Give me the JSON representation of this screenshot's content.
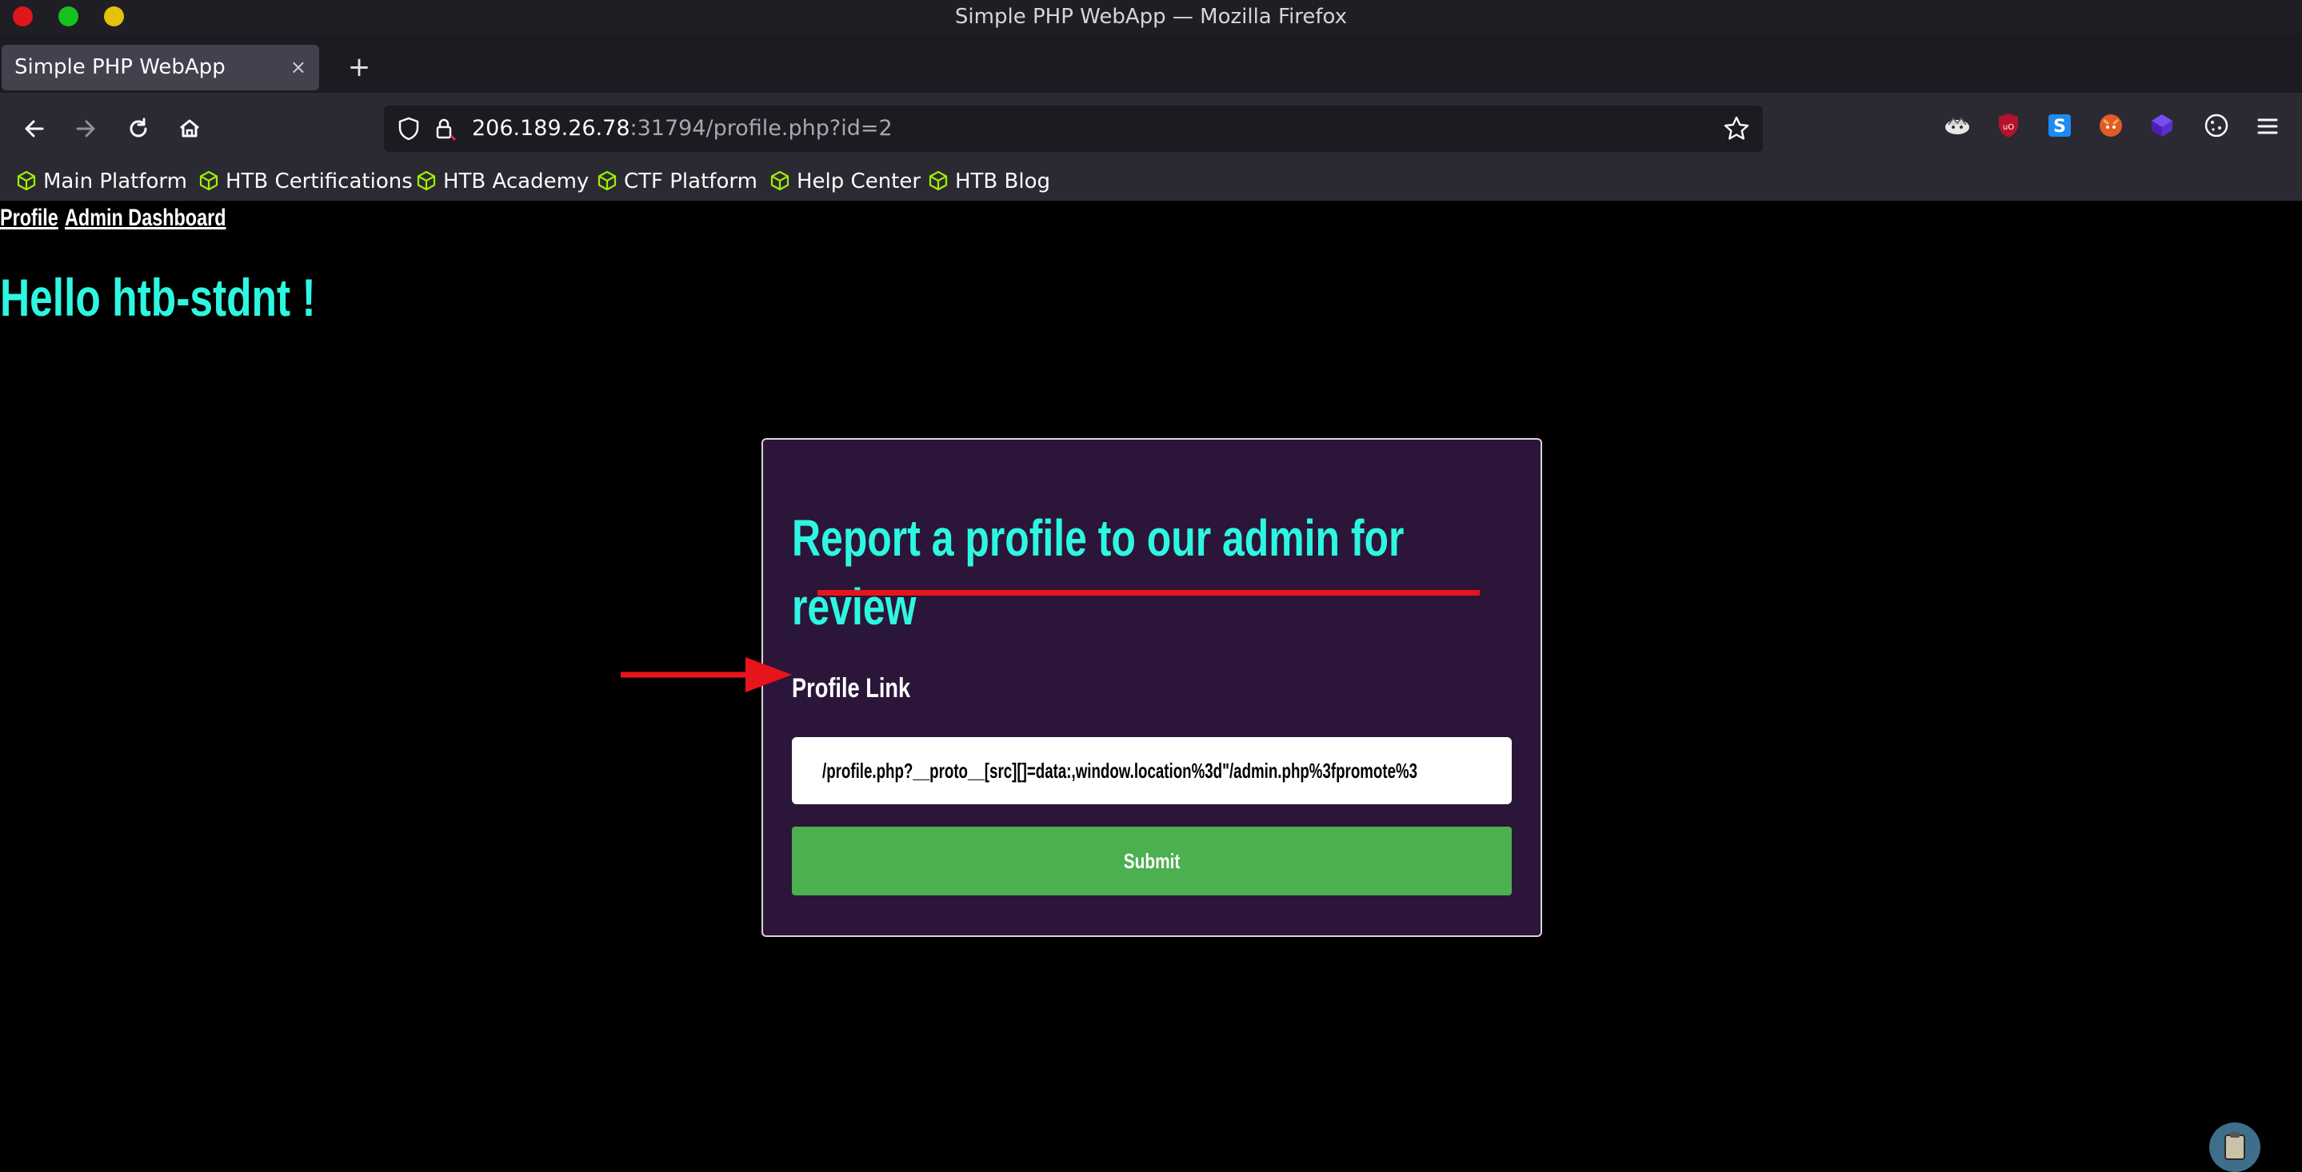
{
  "window": {
    "title": "Simple PHP WebApp — Mozilla Firefox"
  },
  "tab": {
    "label": "Simple PHP WebApp",
    "close": "×",
    "new_tab": "+"
  },
  "navbar": {
    "url_host": "206.189.26.78",
    "url_path": ":31794/profile.php?id=2",
    "icons": [
      "back-icon",
      "forward-icon",
      "reload-icon",
      "home-icon",
      "shield-icon",
      "lock-icon",
      "bookmark-star-icon"
    ]
  },
  "extensions": [
    "hack-the-box-icon",
    "ublock-origin-icon",
    "s-extension-icon",
    "fox-extension-icon",
    "cube-extension-icon",
    "cookie-icon",
    "hamburger-menu-icon"
  ],
  "bookmarks": [
    {
      "label": "Main Platform"
    },
    {
      "label": "HTB Certifications"
    },
    {
      "label": "HTB Academy"
    },
    {
      "label": "CTF Platform"
    },
    {
      "label": "Help Center"
    },
    {
      "label": "HTB Blog"
    }
  ],
  "page": {
    "nav": {
      "profile": "Profile",
      "admin": "Admin Dashboard"
    },
    "greeting": "Hello htb-stdnt !",
    "card": {
      "title": "Report a profile to our admin for review",
      "label": "Profile Link",
      "input_value": "/profile.php?__proto__[src][]=data:,window.location%3d\"/admin.php%3fpromote%3",
      "submit": "Submit"
    }
  },
  "colors": {
    "accent": "#2ef7e1",
    "card_bg": "#2b1639",
    "button": "#4caf50",
    "annotation": "#e8141b"
  }
}
